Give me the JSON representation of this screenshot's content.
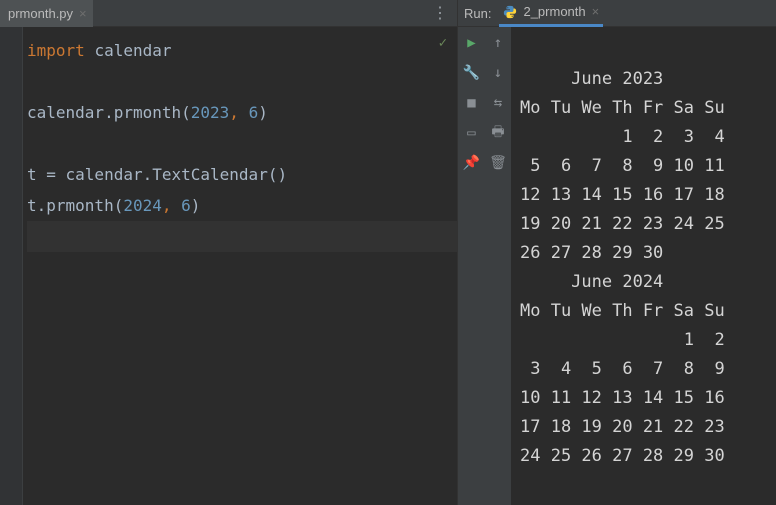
{
  "editor": {
    "tab_filename": "prmonth.py",
    "more_label": "⋮",
    "check_mark": "✓",
    "code_lines": [
      {
        "tokens": [
          {
            "t": "import",
            "c": "k-orange"
          },
          {
            "t": " ",
            "c": "k-white"
          },
          {
            "t": "calendar",
            "c": "k-white"
          }
        ]
      },
      {
        "tokens": []
      },
      {
        "tokens": [
          {
            "t": "calendar.prmonth(",
            "c": "k-white"
          },
          {
            "t": "2023",
            "c": "k-num"
          },
          {
            "t": ", ",
            "c": "k-orange"
          },
          {
            "t": "6",
            "c": "k-num"
          },
          {
            "t": ")",
            "c": "k-white"
          }
        ]
      },
      {
        "tokens": []
      },
      {
        "tokens": [
          {
            "t": "t = calendar.TextCalendar()",
            "c": "k-white"
          }
        ]
      },
      {
        "tokens": [
          {
            "t": "t.prmonth(",
            "c": "k-white"
          },
          {
            "t": "2024",
            "c": "k-num"
          },
          {
            "t": ", ",
            "c": "k-orange"
          },
          {
            "t": "6",
            "c": "k-num"
          },
          {
            "t": ")",
            "c": "k-white"
          }
        ]
      },
      {
        "tokens": [],
        "cursor": true
      }
    ]
  },
  "run": {
    "panel_label": "Run:",
    "tab_label": "2_prmonth",
    "calendars": [
      {
        "title": "     June 2023",
        "header": "Mo Tu We Th Fr Sa Su",
        "weeks": [
          "          1  2  3  4",
          " 5  6  7  8  9 10 11",
          "12 13 14 15 16 17 18",
          "19 20 21 22 23 24 25",
          "26 27 28 29 30"
        ]
      },
      {
        "title": "     June 2024",
        "header": "Mo Tu We Th Fr Sa Su",
        "weeks": [
          "                1  2",
          " 3  4  5  6  7  8  9",
          "10 11 12 13 14 15 16",
          "17 18 19 20 21 22 23",
          "24 25 26 27 28 29 30"
        ]
      }
    ]
  },
  "icons": {
    "close": "×",
    "run_green": "▶",
    "up_arrow": "↑",
    "down_arrow": "↓",
    "wrench": "🔧",
    "stop": "■",
    "wrap": "⇆",
    "layout": "▭",
    "print": "🖶",
    "pin": "📌",
    "trash": "🗑"
  }
}
